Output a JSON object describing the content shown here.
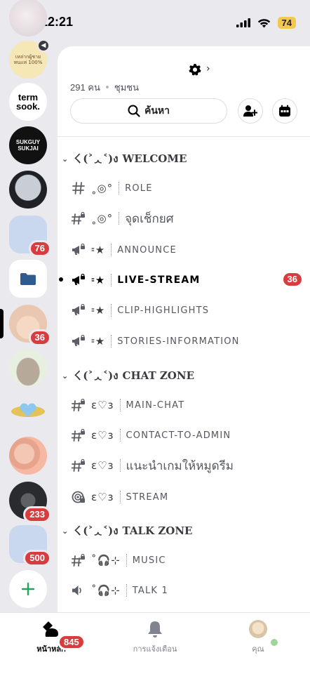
{
  "status_bar": {
    "time": "12:21",
    "battery": "74"
  },
  "servers": [
    {
      "name": "server-1",
      "badge": ""
    },
    {
      "name": "server-2",
      "label": "เหล่ากผู้ชายหนแห่ 100%",
      "badge": ""
    },
    {
      "name": "server-3",
      "label": "term sook.",
      "badge": ""
    },
    {
      "name": "server-4",
      "label": "SUKGUY SUKJAI",
      "badge": ""
    },
    {
      "name": "server-5",
      "badge": ""
    },
    {
      "name": "server-6",
      "badge": "76"
    },
    {
      "name": "server-folder",
      "badge": ""
    },
    {
      "name": "server-8",
      "badge": "36"
    },
    {
      "name": "server-9",
      "badge": ""
    },
    {
      "name": "server-10",
      "badge": ""
    },
    {
      "name": "server-11",
      "badge": ""
    },
    {
      "name": "server-12",
      "badge": "233"
    },
    {
      "name": "server-13",
      "badge": "500"
    }
  ],
  "header": {
    "members": "291 คน",
    "community": "ชุมชน",
    "search_label": "ค้นหา"
  },
  "categories": [
    {
      "deco": "ㄑ(˃ᆺ˂)ง",
      "name": "WELCOME"
    },
    {
      "deco": "ㄑ(˃ᆺ˂)ง",
      "name": "CHAT ZONE"
    },
    {
      "deco": "ㄑ(˃ᆺ˂)ง",
      "name": "TALK ZONE"
    }
  ],
  "channels": [
    {
      "icon": "hash",
      "deco": "˳◎°",
      "name": "Role",
      "thai": false
    },
    {
      "icon": "hash-locked",
      "deco": "˳◎°",
      "name": "จุดเช็กยศ",
      "thai": true
    },
    {
      "icon": "announce",
      "deco": "⹀★",
      "name": "announce",
      "thai": false
    },
    {
      "icon": "announce",
      "deco": "⹀★",
      "name": "Live-stream",
      "thai": false,
      "active": true,
      "badge": "36"
    },
    {
      "icon": "announce",
      "deco": "⹀★",
      "name": "clip-highlights",
      "thai": false
    },
    {
      "icon": "announce",
      "deco": "⹀★",
      "name": "stories-information",
      "thai": false
    },
    {
      "icon": "hash-locked",
      "deco": "ɛ♡ɜ",
      "name": "main-chat",
      "thai": false
    },
    {
      "icon": "hash-locked",
      "deco": "ɛ♡ɜ",
      "name": "contact-to-admin",
      "thai": false
    },
    {
      "icon": "hash-locked",
      "deco": "ɛ♡ɜ",
      "name": "แนะนำเกมให้หมูดรีม",
      "thai": true
    },
    {
      "icon": "stage",
      "deco": "ɛ♡ɜ",
      "name": "stream",
      "thai": false
    },
    {
      "icon": "hash-locked",
      "deco": "˚🎧⊹",
      "name": "music",
      "thai": false
    },
    {
      "icon": "voice",
      "deco": "˚🎧⊹",
      "name": "Talk 1",
      "thai": false
    }
  ],
  "bottom_nav": {
    "home_label": "หน้าหลัก",
    "home_badge": "845",
    "notifications_label": "การแจ้งเตือน",
    "you_label": "คุณ"
  },
  "colors": {
    "badge": "#d83c3e",
    "panel": "#ffffff",
    "rail": "#e9e9ee",
    "folder": "#2f5b8f"
  }
}
